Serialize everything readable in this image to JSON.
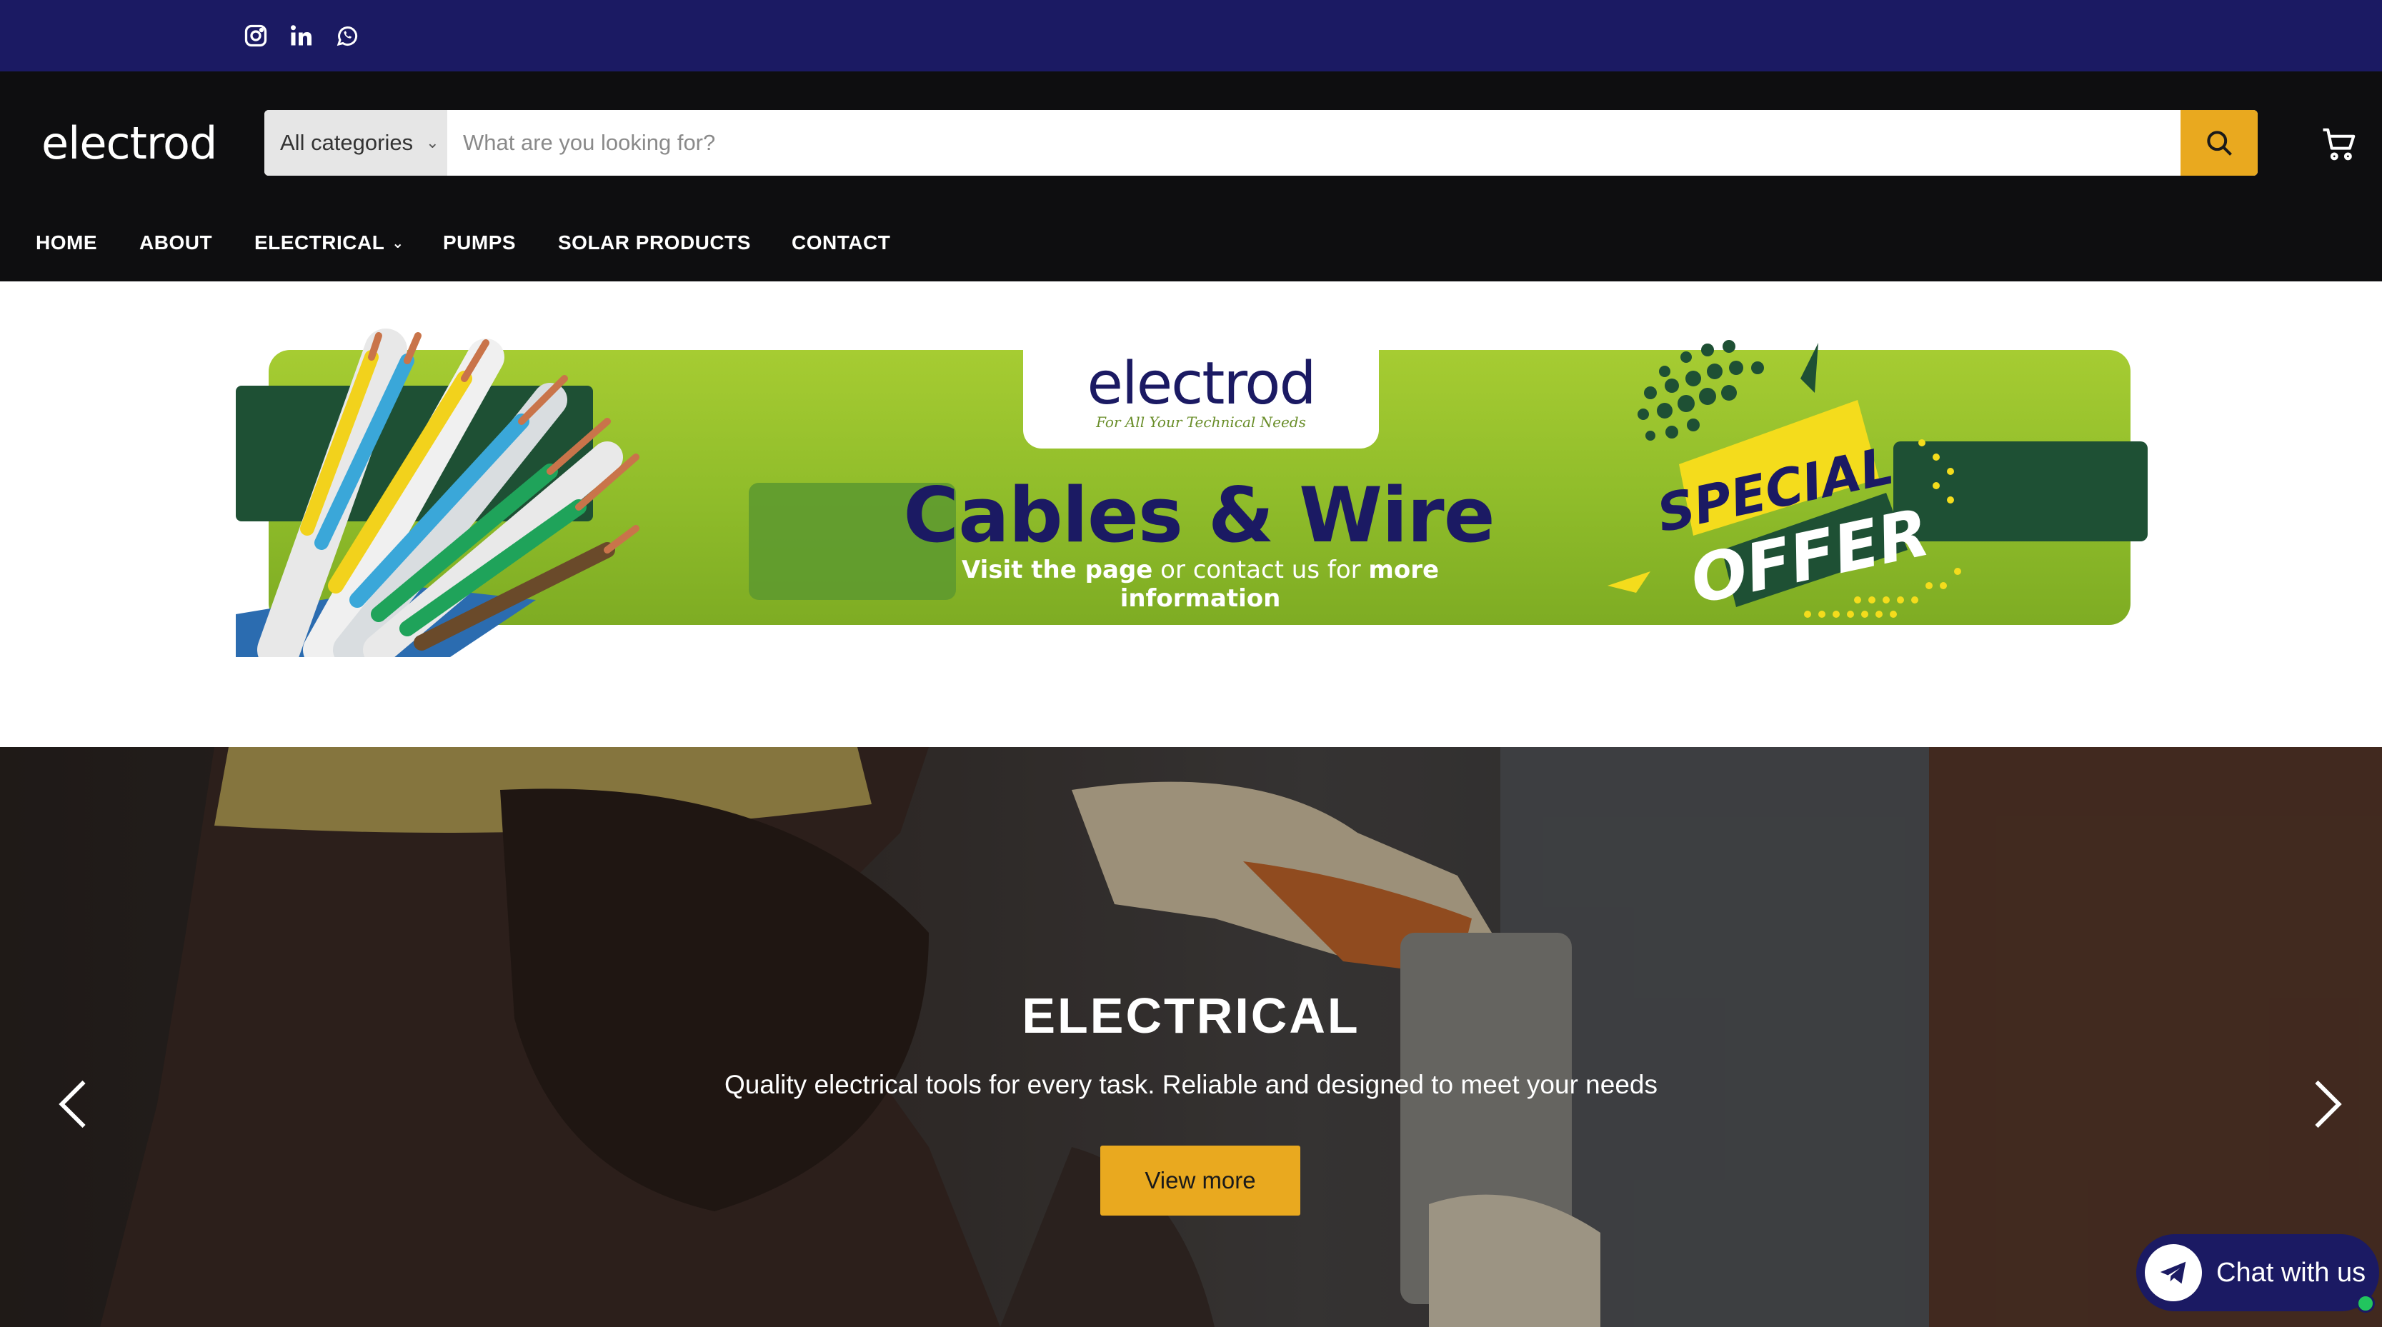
{
  "topbar": {
    "social": [
      {
        "icon": "instagram-icon"
      },
      {
        "icon": "linkedin-icon"
      },
      {
        "icon": "whatsapp-icon"
      }
    ]
  },
  "header": {
    "logo_text": "electrod",
    "search": {
      "category": "All categories",
      "placeholder": "What are you looking for?",
      "value": ""
    },
    "cart_icon": "cart-icon"
  },
  "nav": {
    "items": [
      {
        "label": "HOME"
      },
      {
        "label": "ABOUT"
      },
      {
        "label": "ELECTRICAL",
        "has_dropdown": true
      },
      {
        "label": "PUMPS"
      },
      {
        "label": "SOLAR PRODUCTS"
      },
      {
        "label": "CONTACT"
      }
    ]
  },
  "promo": {
    "logo": "electrod",
    "tagline": "For All Your Technical Needs",
    "title": "Cables & Wire",
    "sub_bold_1": "Visit the page",
    "sub_plain": " or contact us for ",
    "sub_bold_2": "more information",
    "badge_line1": "SPECIAL",
    "badge_line2": "OFFER"
  },
  "hero": {
    "title": "ELECTRICAL",
    "description": "Quality electrical tools for every task. Reliable and designed to meet your needs",
    "button": "View more"
  },
  "chat": {
    "label": "Chat with us"
  },
  "colors": {
    "topbar": "#1b1a63",
    "header": "#0e0e10",
    "accent": "#e9a91f",
    "promo_green": "#8fbc2a",
    "brand_navy": "#1b1a63"
  }
}
